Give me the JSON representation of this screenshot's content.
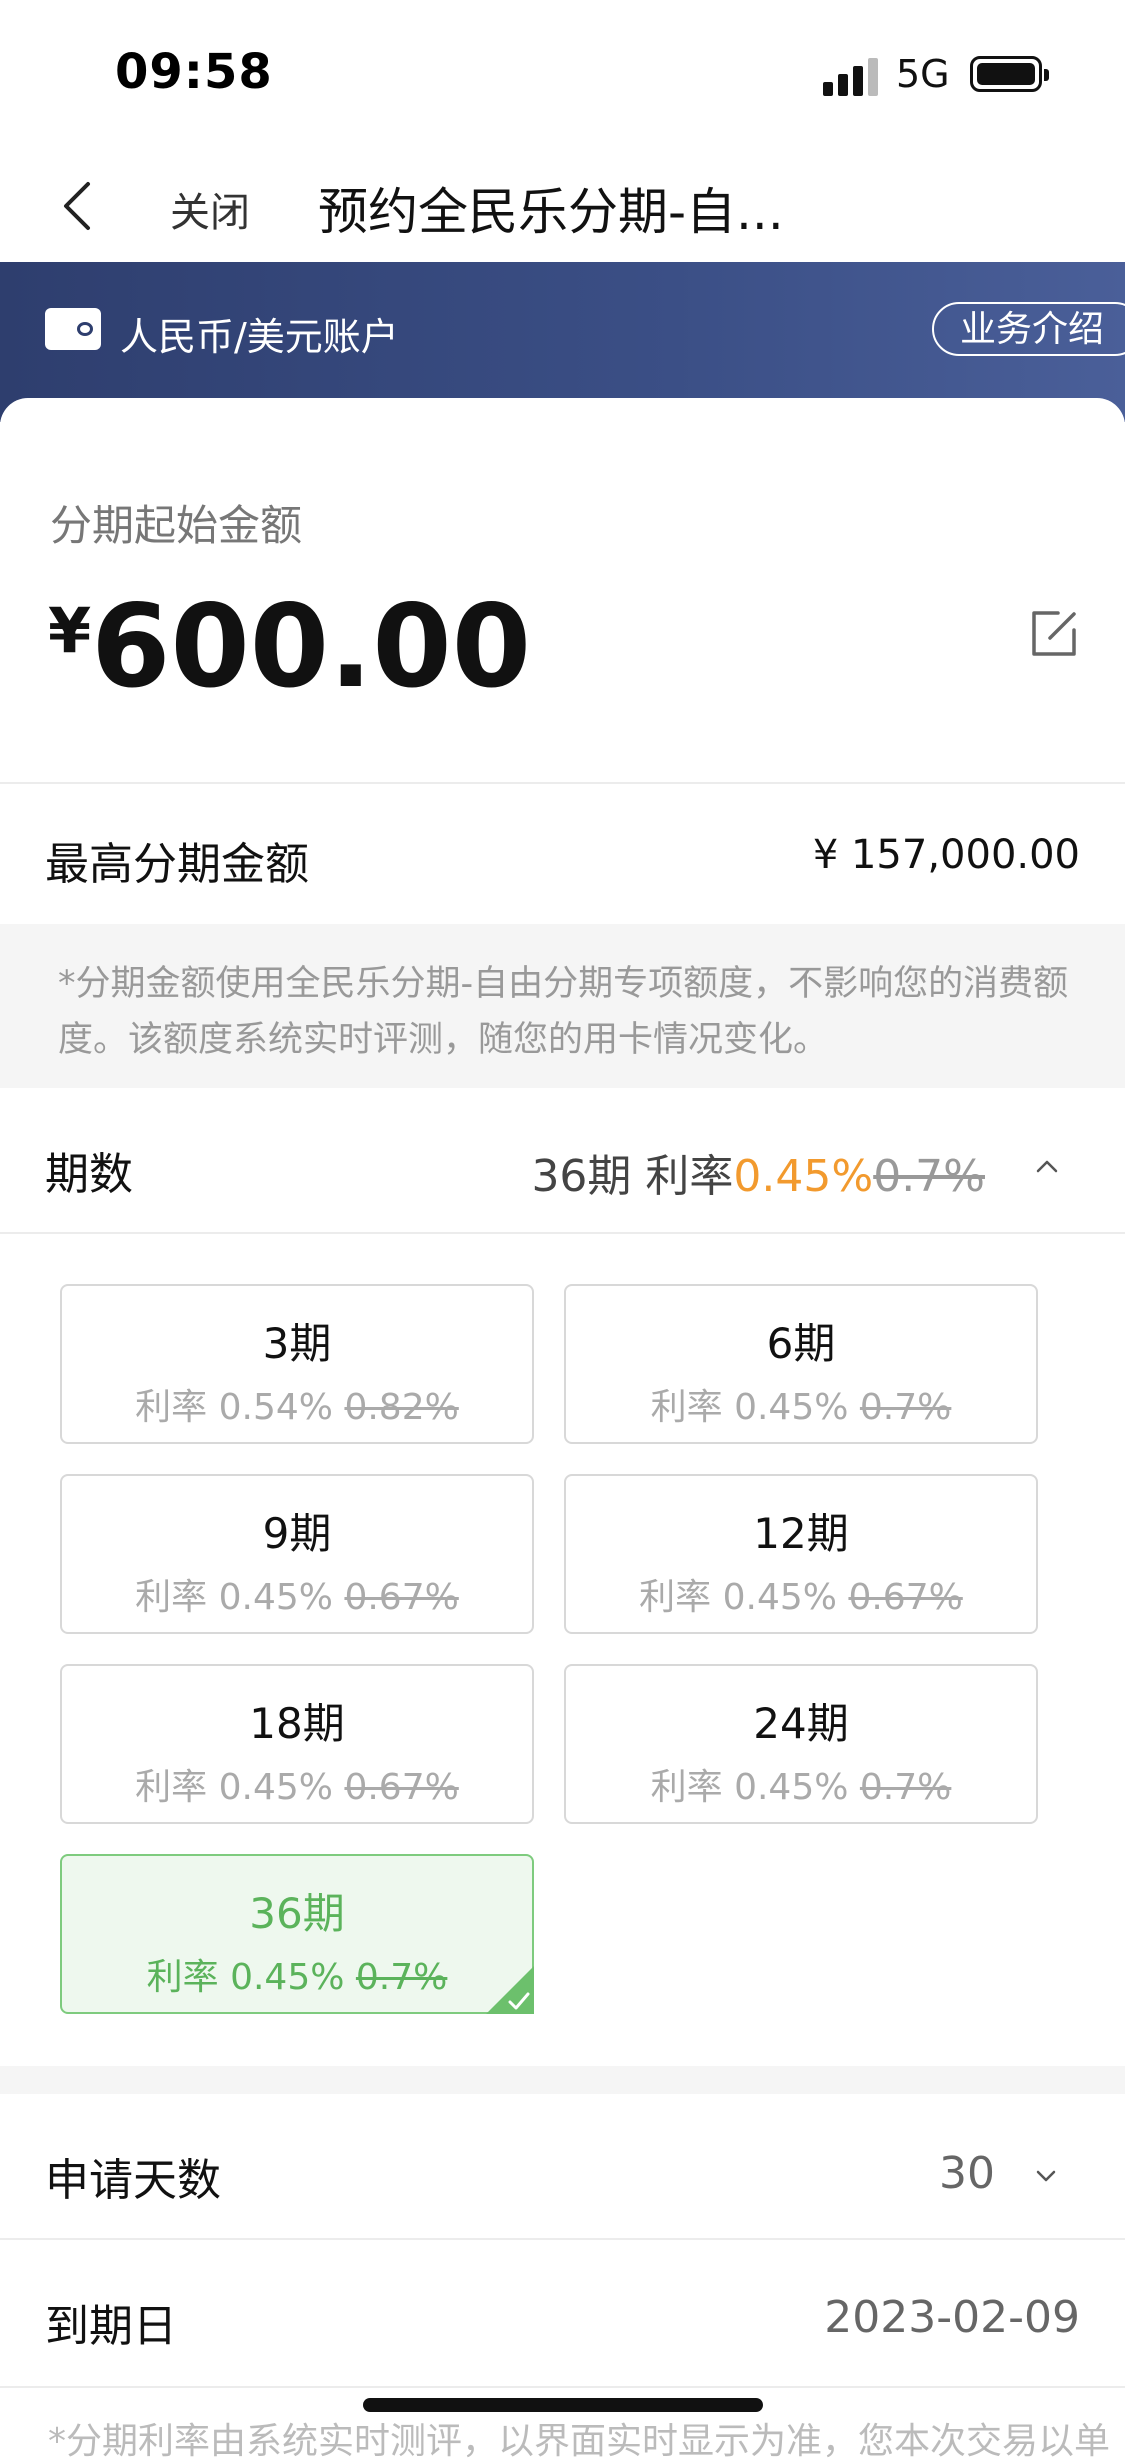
{
  "status": {
    "time": "09:58",
    "network": "5G"
  },
  "nav": {
    "close_label": "关闭",
    "title": "预约全民乐分期-自..."
  },
  "banner": {
    "account_label": "人民币/美元账户",
    "intro_label": "业务介绍"
  },
  "start": {
    "label": "分期起始金额",
    "currency": "¥",
    "amount": "600.00"
  },
  "max": {
    "label": "最高分期金额",
    "value": "¥ 157,000.00"
  },
  "notice": "*分期金额使用全民乐分期-自由分期专项额度，不影响您的消费额度。该额度系统实时评测，随您的用卡情况变化。",
  "period": {
    "label": "期数",
    "selected_text": "36期 利率",
    "selected_rate": "0.45%",
    "selected_old_rate": "0.7%"
  },
  "options": [
    {
      "term": "3期",
      "rate_text": "利率 0.54%",
      "old_rate": "0.82%"
    },
    {
      "term": "6期",
      "rate_text": "利率 0.45%",
      "old_rate": "0.7%"
    },
    {
      "term": "9期",
      "rate_text": "利率 0.45%",
      "old_rate": "0.67%"
    },
    {
      "term": "12期",
      "rate_text": "利率 0.45%",
      "old_rate": "0.67%"
    },
    {
      "term": "18期",
      "rate_text": "利率 0.45%",
      "old_rate": "0.67%"
    },
    {
      "term": "24期",
      "rate_text": "利率 0.45%",
      "old_rate": "0.7%"
    },
    {
      "term": "36期",
      "rate_text": "利率 0.45%",
      "old_rate": "0.7%"
    }
  ],
  "days": {
    "label": "申请天数",
    "value": "30"
  },
  "due": {
    "label": "到期日",
    "value": "2023-02-09"
  },
  "footnote": "*分期利率由系统实时测评，以界面实时显示为准，您本次交易以单"
}
